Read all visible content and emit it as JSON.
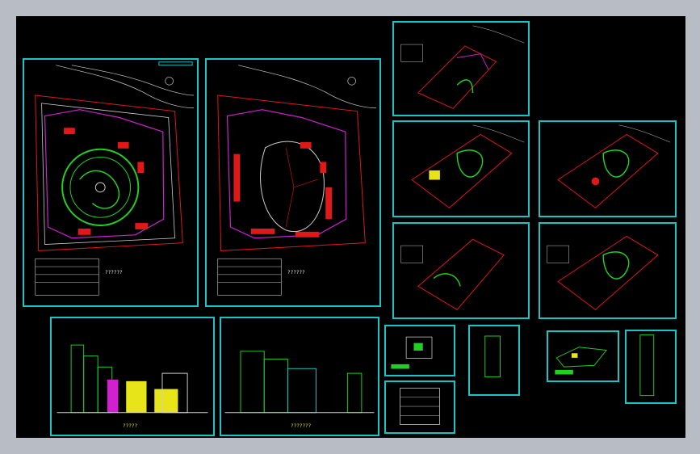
{
  "colors": {
    "background": "#000000",
    "frame": "#b8bcc4",
    "border": "#19c4c4",
    "green": "#22d022",
    "magenta": "#d020d0",
    "red": "#e01818",
    "yellow": "#e8e41a",
    "white": "#f0f0f0"
  },
  "sheets": {
    "site_plan_1": {
      "scale_label": "??????"
    },
    "site_plan_2": {
      "scale_label": "??????"
    },
    "elevation_1": {
      "caption": "?????"
    },
    "elevation_2": {
      "caption": "???????"
    }
  }
}
